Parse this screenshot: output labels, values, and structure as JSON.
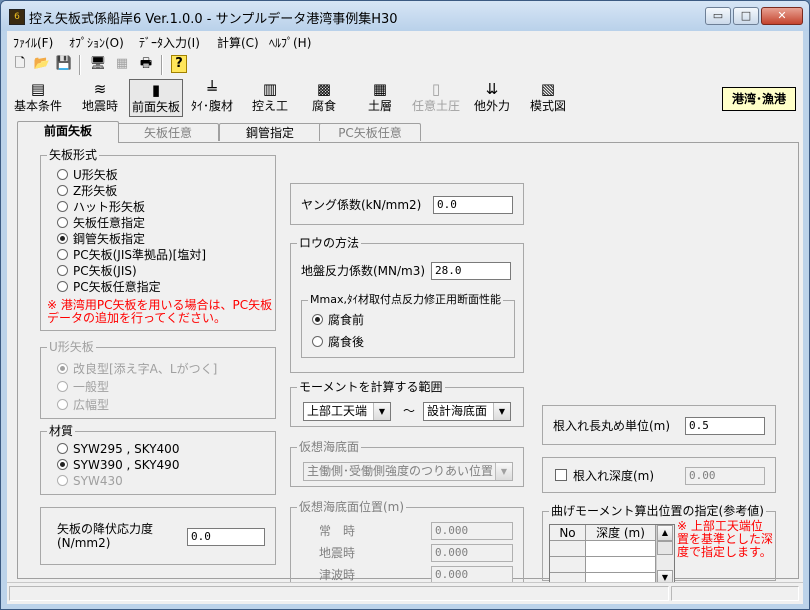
{
  "window": {
    "title": "控え矢板式係船岸6 Ver.1.0.0 - サンプルデータ港湾事例集H30",
    "app_icon": "6",
    "min": "▭",
    "max": "□",
    "close": "✕"
  },
  "menu": [
    "ﾌｧｲﾙ(F)",
    "ｵﾌﾟｼｮﾝ(O)",
    "ﾃﾞｰﾀ入力(I)",
    "計算(C)",
    "ﾍﾙﾌﾟ(H)"
  ],
  "toolbar_icons": [
    {
      "name": "new-file-icon",
      "glyph": "🗋"
    },
    {
      "name": "open-folder-icon",
      "glyph": "📂"
    },
    {
      "name": "save-icon",
      "glyph": "💾"
    },
    {
      "name": "monitor-icon",
      "glyph": "🖥"
    },
    {
      "name": "grid-icon",
      "glyph": "▦"
    },
    {
      "name": "print-icon",
      "glyph": "🖶"
    },
    {
      "name": "help-icon",
      "glyph": "?"
    }
  ],
  "modules": [
    {
      "label": "基本条件",
      "glyph": "▤"
    },
    {
      "label": "地震時",
      "glyph": "≋"
    },
    {
      "label": "前面矢板",
      "glyph": "▮"
    },
    {
      "label": "ﾀｲ･腹材",
      "glyph": "╧"
    },
    {
      "label": "控え工",
      "glyph": "▥"
    },
    {
      "label": "腐食",
      "glyph": "▩"
    },
    {
      "label": "土層",
      "glyph": "▦"
    },
    {
      "label": "任意土圧",
      "glyph": "▯"
    },
    {
      "label": "他外力",
      "glyph": "⇊"
    },
    {
      "label": "模式図",
      "glyph": "▧"
    }
  ],
  "badge": "港湾･漁港",
  "tabs": [
    "前面矢板",
    "矢板任意",
    "鋼管指定",
    "PC矢板任意"
  ],
  "sheet_type": {
    "legend": "矢板形式",
    "options": [
      "U形矢板",
      "Z形矢板",
      "ハット形矢板",
      "矢板任意指定",
      "鋼管矢板指定",
      "PC矢板(JIS準拠品)[塩対]",
      "PC矢板(JIS)",
      "PC矢板任意指定"
    ],
    "selected": 4,
    "note_line1": "※ 港湾用PC矢板を用いる場合は、PC矢板",
    "note_line2": "データの追加を行ってください。"
  },
  "u_sheet": {
    "legend": "U形矢板",
    "options": [
      "改良型[添え字A、Lがつく]",
      "一般型",
      "広幅型"
    ],
    "selected": 0
  },
  "material": {
    "legend": "材質",
    "options": [
      "SYW295 , SKY400",
      "SYW390 , SKY490",
      "SYW430"
    ],
    "selected": 1
  },
  "yield_stress": {
    "label_line1": "矢板の降伏応力度",
    "label_line2": "(N/mm2)",
    "value": "0.0"
  },
  "young": {
    "label": "ヤング係数(kN/mm2)",
    "value": "0.0"
  },
  "rowe": {
    "legend": "ロウの方法",
    "subgrade_label": "地盤反力係数(MN/m3)",
    "subgrade_value": "28.0",
    "sub_legend": "Mmax,ﾀｲ材取付点反力修正用断面性能",
    "options": [
      "腐食前",
      "腐食後"
    ],
    "selected": 0
  },
  "moment_range": {
    "legend": "モーメントを計算する範囲",
    "from": "上部工天端",
    "sep": "〜",
    "to": "設計海底面"
  },
  "virtual_seabed": {
    "legend": "仮想海底面",
    "value": "主働側･受働側強度のつりあい位置"
  },
  "virtual_seabed_pos": {
    "legend": "仮想海底面位置(m)",
    "rows": [
      {
        "label": "常　時",
        "value": "0.000"
      },
      {
        "label": "地震時",
        "value": "0.000"
      },
      {
        "label": "津波時",
        "value": "0.000"
      }
    ]
  },
  "embed_round": {
    "label": "根入れ長丸め単位(m)",
    "value": "0.5"
  },
  "embed_depth": {
    "label": "根入れ深度(m)",
    "value": "0.00"
  },
  "bending": {
    "legend": "曲げモーメント算出位置の指定(参考値)",
    "col_no": "No",
    "col_depth": "深度 (m)",
    "note_lines": [
      "※ 上部工天端位",
      "置を基準とした深",
      "度で指定します。"
    ]
  }
}
